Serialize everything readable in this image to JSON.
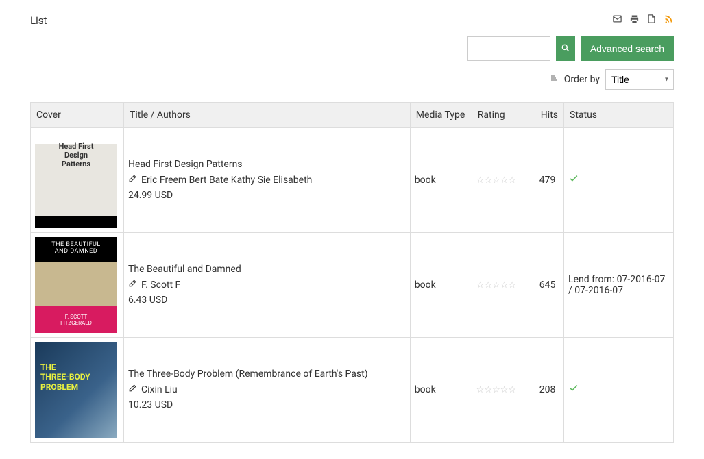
{
  "page": {
    "title": "List"
  },
  "search": {
    "placeholder": "",
    "value": "",
    "advanced_label": "Advanced search"
  },
  "orderby": {
    "label": "Order by",
    "selected": "Title"
  },
  "table": {
    "headers": {
      "cover": "Cover",
      "title": "Title / Authors",
      "media": "Media Type",
      "rating": "Rating",
      "hits": "Hits",
      "status": "Status"
    },
    "rows": [
      {
        "cover_class": "cover-1",
        "title": "Head First Design Patterns",
        "authors": "Eric Freem Bert Bate Kathy Sie Elisabeth",
        "price": "24.99 USD",
        "media": "book",
        "rating": 0,
        "hits": "479",
        "status": {
          "type": "check",
          "text": ""
        }
      },
      {
        "cover_class": "cover-2",
        "title": "The Beautiful and Damned",
        "authors": "F. Scott F",
        "price": "6.43 USD",
        "media": "book",
        "rating": 0,
        "hits": "645",
        "status": {
          "type": "text",
          "text": "Lend from: 07-2016-07 / 07-2016-07"
        }
      },
      {
        "cover_class": "cover-3",
        "title": "The Three-Body Problem (Remembrance of Earth's Past)",
        "authors": "Cixin Liu",
        "price": "10.23 USD",
        "media": "book",
        "rating": 0,
        "hits": "208",
        "status": {
          "type": "check",
          "text": ""
        }
      }
    ]
  }
}
